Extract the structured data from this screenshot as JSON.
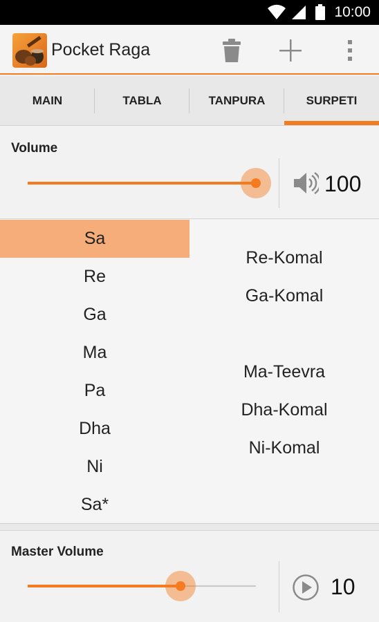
{
  "status_bar": {
    "time": "10:00",
    "icons": [
      "wifi-icon",
      "cell-signal-icon",
      "battery-icon"
    ]
  },
  "app_bar": {
    "title": "Pocket Raga",
    "icon": "pocket-raga-app-icon",
    "actions": [
      "trash-icon",
      "add-icon",
      "overflow-menu-icon"
    ]
  },
  "tabs": [
    {
      "label": "MAIN",
      "active": false
    },
    {
      "label": "TABLA",
      "active": false
    },
    {
      "label": "TANPURA",
      "active": false
    },
    {
      "label": "SURPETI",
      "active": true
    }
  ],
  "volume": {
    "label": "Volume",
    "value": "100",
    "level_percent": 100,
    "icon": "speaker-icon"
  },
  "notes": {
    "primary": [
      {
        "label": "Sa",
        "selected": true
      },
      {
        "label": "Re",
        "selected": false
      },
      {
        "label": "Ga",
        "selected": false
      },
      {
        "label": "Ma",
        "selected": false
      },
      {
        "label": "Pa",
        "selected": false
      },
      {
        "label": "Dha",
        "selected": false
      },
      {
        "label": "Ni",
        "selected": false
      },
      {
        "label": "Sa*",
        "selected": false
      }
    ],
    "alternate": [
      {
        "label": "Re-Komal",
        "selected": false
      },
      {
        "label": "Ga-Komal",
        "selected": false
      },
      {
        "label": "Ma-Teevra",
        "selected": false
      },
      {
        "label": "Dha-Komal",
        "selected": false
      },
      {
        "label": "Ni-Komal",
        "selected": false
      }
    ]
  },
  "master_volume": {
    "label": "Master Volume",
    "value": "10",
    "level_percent": 67,
    "icon": "play-icon"
  },
  "colors": {
    "accent": "#f47b20",
    "selected_note_bg": "#f7ad79"
  }
}
